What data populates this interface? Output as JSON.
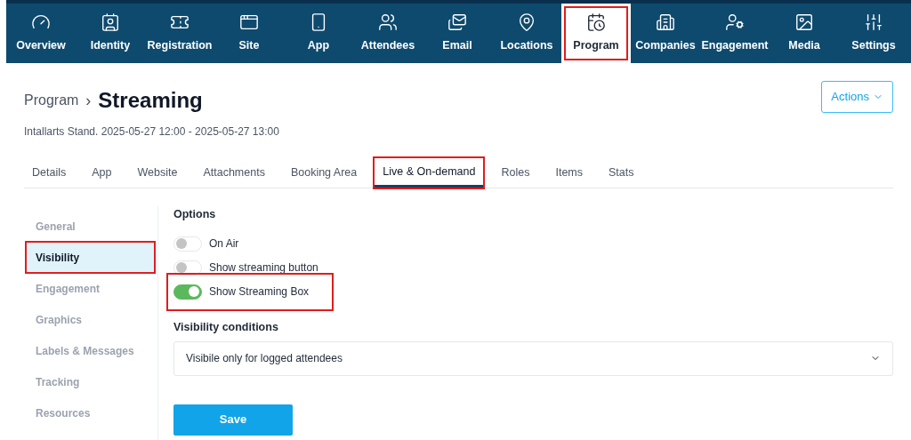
{
  "nav": [
    {
      "label": "Overview",
      "selected": false,
      "highlighted": false
    },
    {
      "label": "Identity",
      "selected": false,
      "highlighted": false
    },
    {
      "label": "Registration",
      "selected": false,
      "highlighted": false
    },
    {
      "label": "Site",
      "selected": false,
      "highlighted": false
    },
    {
      "label": "App",
      "selected": false,
      "highlighted": false
    },
    {
      "label": "Attendees",
      "selected": false,
      "highlighted": false
    },
    {
      "label": "Email",
      "selected": false,
      "highlighted": false
    },
    {
      "label": "Locations",
      "selected": false,
      "highlighted": false
    },
    {
      "label": "Program",
      "selected": true,
      "highlighted": true
    },
    {
      "label": "Companies",
      "selected": false,
      "highlighted": false
    },
    {
      "label": "Engagement",
      "selected": false,
      "highlighted": false
    },
    {
      "label": "Media",
      "selected": false,
      "highlighted": false
    },
    {
      "label": "Settings",
      "selected": false,
      "highlighted": false
    }
  ],
  "breadcrumb": {
    "parent": "Program",
    "separator": "›",
    "title": "Streaming"
  },
  "actions_button": "Actions",
  "subtitle": "Intallarts Stand. 2025-05-27 12:00 - 2025-05-27 13:00",
  "tabs": [
    {
      "label": "Details",
      "selected": false,
      "highlighted": false
    },
    {
      "label": "App",
      "selected": false,
      "highlighted": false
    },
    {
      "label": "Website",
      "selected": false,
      "highlighted": false
    },
    {
      "label": "Attachments",
      "selected": false,
      "highlighted": false
    },
    {
      "label": "Booking Area",
      "selected": false,
      "highlighted": false
    },
    {
      "label": "Live & On-demand",
      "selected": true,
      "highlighted": true
    },
    {
      "label": "Roles",
      "selected": false,
      "highlighted": false
    },
    {
      "label": "Items",
      "selected": false,
      "highlighted": false
    },
    {
      "label": "Stats",
      "selected": false,
      "highlighted": false
    }
  ],
  "sidebar": {
    "items": [
      {
        "label": "General",
        "selected": false,
        "highlighted": false
      },
      {
        "label": "Visibility",
        "selected": true,
        "highlighted": true
      },
      {
        "label": "Engagement",
        "selected": false,
        "highlighted": false
      },
      {
        "label": "Graphics",
        "selected": false,
        "highlighted": false
      },
      {
        "label": "Labels & Messages",
        "selected": false,
        "highlighted": false
      },
      {
        "label": "Tracking",
        "selected": false,
        "highlighted": false
      },
      {
        "label": "Resources",
        "selected": false,
        "highlighted": false
      }
    ]
  },
  "options": {
    "heading": "Options",
    "toggles": [
      {
        "label": "On Air",
        "on": false,
        "highlighted": false
      },
      {
        "label": "Show streaming button",
        "on": false,
        "highlighted": false
      },
      {
        "label": "Show Streaming Box",
        "on": true,
        "highlighted": true
      }
    ]
  },
  "visibility_conditions": {
    "label": "Visibility conditions",
    "value": "Visibile only for logged attendees"
  },
  "save_button": "Save"
}
